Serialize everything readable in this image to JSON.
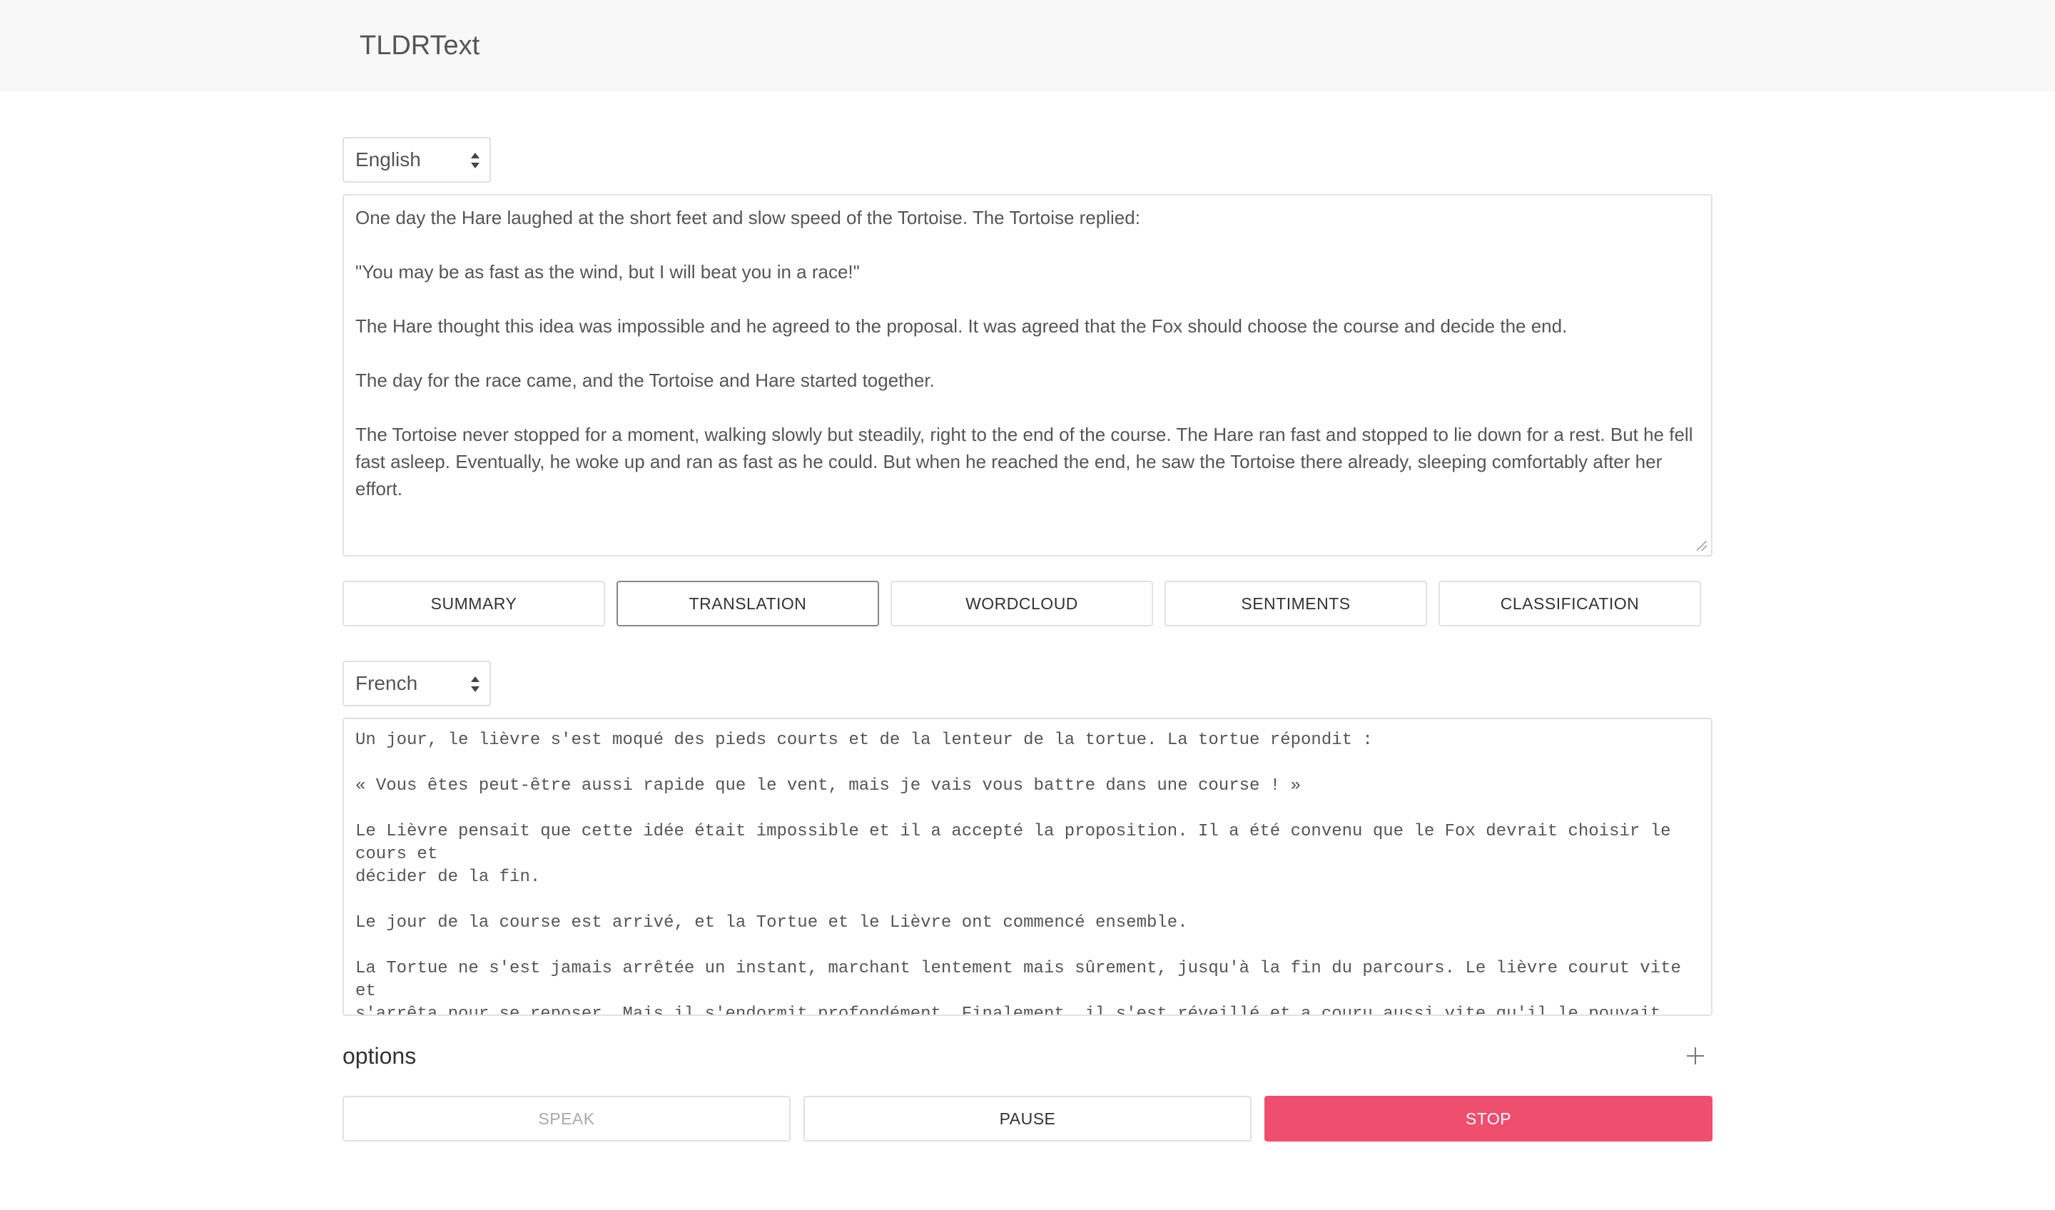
{
  "app": {
    "title": "TLDRText"
  },
  "source_language": {
    "selected": "English"
  },
  "input_text": "One day the Hare laughed at the short feet and slow speed of the Tortoise. The Tortoise replied:\n\n\"You may be as fast as the wind, but I will beat you in a race!\"\n\nThe Hare thought this idea was impossible and he agreed to the proposal. It was agreed that the Fox should choose the course and decide the end.\n\nThe day for the race came, and the Tortoise and Hare started together.\n\nThe Tortoise never stopped for a moment, walking slowly but steadily, right to the end of the course. The Hare ran fast and stopped to lie down for a rest. But he fell fast asleep. Eventually, he woke up and ran as fast as he could. But when he reached the end, he saw the Tortoise there already, sleeping comfortably after her effort.",
  "tabs": [
    {
      "label": "SUMMARY",
      "active": false
    },
    {
      "label": "TRANSLATION",
      "active": true
    },
    {
      "label": "WORDCLOUD",
      "active": false
    },
    {
      "label": "SENTIMENTS",
      "active": false
    },
    {
      "label": "CLASSIFICATION",
      "active": false
    }
  ],
  "target_language": {
    "selected": "French"
  },
  "output_text": "Un jour, le lièvre s'est moqué des pieds courts et de la lenteur de la tortue. La tortue répondit :\n\n« Vous êtes peut-être aussi rapide que le vent, mais je vais vous battre dans une course ! »\n\nLe Lièvre pensait que cette idée était impossible et il a accepté la proposition. Il a été convenu que le Fox devrait choisir le cours et\ndécider de la fin.\n\nLe jour de la course est arrivé, et la Tortue et le Lièvre ont commencé ensemble.\n\nLa Tortue ne s'est jamais arrêtée un instant, marchant lentement mais sûrement, jusqu'à la fin du parcours. Le lièvre courut vite et\ns'arrêta pour se reposer. Mais il s'endormit profondément. Finalement, il s'est réveillé et a couru aussi vite qu'il le pouvait. Mais\nlorsqu'il arriva au bout, il y vit déjà la Tortue, endormie confortablement après son effort.",
  "options": {
    "label": "options"
  },
  "actions": {
    "speak": "SPEAK",
    "pause": "PAUSE",
    "stop": "STOP"
  },
  "colors": {
    "accent": "#f04e6e",
    "topbar": "#f8f8f8",
    "border": "#e1e1e1"
  }
}
